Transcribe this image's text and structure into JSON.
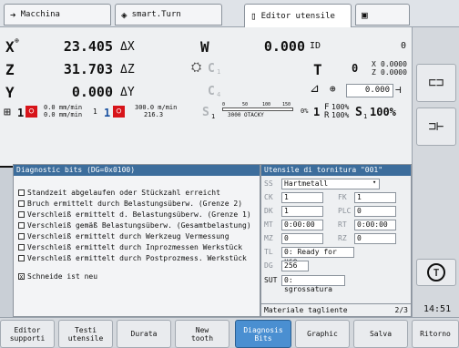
{
  "tabs": [
    {
      "label": "Macchina",
      "icon": "arrow-right-icon"
    },
    {
      "label": "smart.Turn",
      "icon": "diamond-arrow-icon"
    },
    {
      "label": "Editor utensile",
      "icon": "document-icon"
    },
    {
      "label": "",
      "icon": "save-icon"
    }
  ],
  "positions": {
    "x": {
      "axis": "X",
      "sup": "⊕",
      "value": "23.405",
      "delta": "ΔX"
    },
    "z": {
      "axis": "Z",
      "value": "31.703",
      "delta": "ΔZ"
    },
    "y": {
      "axis": "Y",
      "value": "0.000",
      "delta": "ΔY"
    },
    "w": {
      "axis": "W",
      "value": "0.000",
      "id_label": "ID",
      "id_value": "0"
    },
    "c1": {
      "axis": "C",
      "sub": "1"
    },
    "t": {
      "axis": "T",
      "value": "0",
      "x_label": "X",
      "x_val": "0.0000",
      "z_label": "Z",
      "z_val": "0.0000"
    },
    "c4": {
      "axis": "C",
      "sub": "4"
    },
    "spindle_val": "0.000"
  },
  "status_line": {
    "channel1": "1",
    "feed1a": "0.0 mm/min",
    "feed1b": "0.0 mm/min",
    "ch2": "1",
    "ch2b": "1",
    "feed2a": "300.0 m/min",
    "feed2b": "216.3",
    "s_label": "S",
    "s_sub": "1",
    "scale_labels": [
      "0",
      "50",
      "100",
      "150"
    ],
    "otacky": "3000 OTACKY",
    "pct_label": "0%",
    "f_label": "F",
    "f_pct": "100%",
    "r_label": "R",
    "r_pct": "100%",
    "s2_label": "S",
    "s2_sub": "1",
    "s2_pct": "100%",
    "tool_num": "1"
  },
  "diagnostic": {
    "title": "Diagnostic bits   (DG=0x0100)",
    "items": [
      {
        "label": "Standzeit abgelaufen oder Stückzahl erreicht",
        "checked": false
      },
      {
        "label": "Bruch ermittelt durch Belastungsüberw. (Grenze 2)",
        "checked": false
      },
      {
        "label": "Verschleiß ermittelt d. Belastungsüberw. (Grenze 1)",
        "checked": false
      },
      {
        "label": "Verschleiß gemäß Belastungsüberw. (Gesamtbelastung)",
        "checked": false
      },
      {
        "label": "Verschleiß ermittelt durch Werkzeug Vermessung",
        "checked": false
      },
      {
        "label": "Verschleiß ermittelt durch Inprozmessen Werkstück",
        "checked": false
      },
      {
        "label": "Verschleiß ermittelt durch Postprozmess. Werkstück",
        "checked": false
      },
      {
        "label": "Schneide ist neu",
        "checked": true
      }
    ]
  },
  "tool": {
    "title": "Utensile di tornitura \"001\"",
    "ss_label": "SS",
    "ss_value": "Hartmetall",
    "ck_label": "CK",
    "ck_value": "1",
    "fk_label": "FK",
    "fk_value": "1",
    "dk_label": "DK",
    "dk_value": "1",
    "plc_label": "PLC",
    "plc_value": "0",
    "mt_label": "MT",
    "mt_value": "0:00:00",
    "rt_label": "RT",
    "rt_value": "0:00:00",
    "mz_label": "MZ",
    "mz_value": "0",
    "rz_label": "RZ",
    "rz_value": "0",
    "tl_label": "TL",
    "tl_value": "0: Ready for use",
    "dg_label": "DG",
    "dg_value": "256",
    "sut_label": "SUT",
    "sut_value": "0: sgrossatura",
    "footer_label": "Materiale tagliente",
    "page": "2/3"
  },
  "clock": "14:51",
  "softkeys": [
    {
      "label": "Editor\nsupporti",
      "active": false
    },
    {
      "label": "Testi\nutensile",
      "active": false
    },
    {
      "label": "Durata",
      "active": false
    },
    {
      "label": "New\ntooth",
      "active": false
    },
    {
      "label": "Diagnosis\nBits",
      "active": true
    },
    {
      "label": "Graphic",
      "active": false
    },
    {
      "label": "Salva",
      "active": false
    },
    {
      "label": "Ritorno",
      "active": false
    }
  ]
}
